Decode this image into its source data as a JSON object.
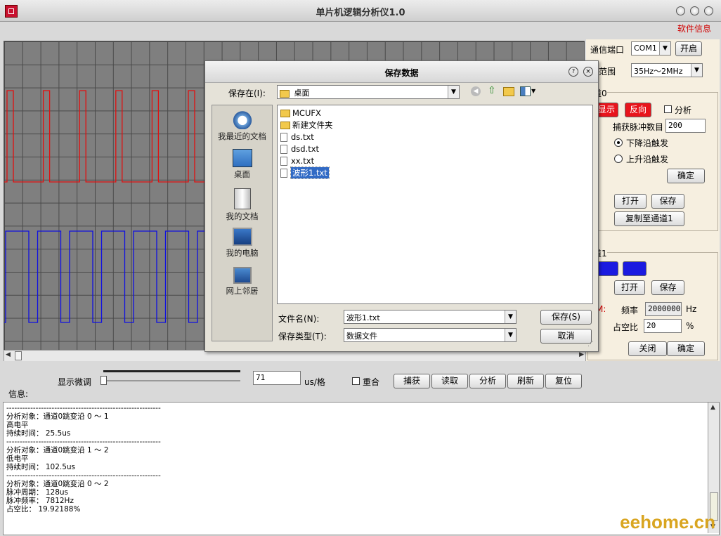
{
  "window": {
    "title": "单片机逻辑分析仪1.0",
    "menu_info": "软件信息"
  },
  "right_panel": {
    "port_label": "通信端口",
    "port_value": "COM1",
    "open_button": "开启",
    "freq_range_label": "率范围",
    "freq_range_value": "35Hz～2MHz",
    "ch0": {
      "group_label": "道0",
      "show_button": "显示",
      "invert_button": "反向",
      "analyze_label": "分析",
      "capture_count_label": "捕获脉冲数目",
      "capture_count_value": "200",
      "falling_label": "下降沿触发",
      "rising_label": "上升沿触发",
      "confirm_button": "确定",
      "open_button": "打开",
      "save_button": "保存",
      "copy_button": "复制至通道1"
    },
    "ch1": {
      "group_label": "道1",
      "open_button": "打开",
      "save_button": "保存",
      "pwm_label": "M:",
      "freq_label": "频率",
      "freq_value": "2000000",
      "freq_unit": "Hz",
      "duty_label": "占空比",
      "duty_value": "20",
      "duty_unit": "%",
      "close_button": "关闭",
      "confirm_button": "确定"
    }
  },
  "dialog": {
    "title": "保存数据",
    "save_in_label": "保存在(I):",
    "save_in_value": "桌面",
    "places": [
      "我最近的文档",
      "桌面",
      "我的文档",
      "我的电脑",
      "网上邻居"
    ],
    "files": [
      {
        "name": "MCUFX",
        "type": "folder"
      },
      {
        "name": "新建文件夹",
        "type": "folder"
      },
      {
        "name": "ds.txt",
        "type": "file"
      },
      {
        "name": "dsd.txt",
        "type": "file"
      },
      {
        "name": "xx.txt",
        "type": "file"
      },
      {
        "name": "波形1.txt",
        "type": "file",
        "selected": true
      }
    ],
    "filename_label": "文件名(N):",
    "filename_value": "波形1.txt",
    "filetype_label": "保存类型(T):",
    "filetype_value": "数据文件",
    "save_button": "保存(S)",
    "cancel_button": "取消"
  },
  "bottom": {
    "fine_label": "显示微调",
    "scale_value": "71",
    "scale_unit": "us/格",
    "overlap_label": "重合",
    "buttons": [
      "捕获",
      "读取",
      "分析",
      "刷新",
      "复位"
    ],
    "info_label": "信息:"
  },
  "info_lines": [
    "----------------------------------------------------------",
    "分析对象：通道0跳变沿 0 ～ 1",
    "高电平",
    "持续时间： 25.5us",
    "----------------------------------------------------------",
    "分析对象：通道0跳变沿 1 ～ 2",
    "低电平",
    "持续时间： 102.5us",
    "----------------------------------------------------------",
    "分析对象：通道0跳变沿 0 ～ 2",
    "脉冲周期： 128us",
    "脉冲频率： 7812Hz",
    "占空比： 19.92188%"
  ],
  "watermark": "eehome.cn",
  "colors": {
    "ch0_wave": "#e01010",
    "ch1_wave": "#1010e0",
    "scope_bg": "#7f7f7f",
    "accent_red": "#d00000"
  }
}
